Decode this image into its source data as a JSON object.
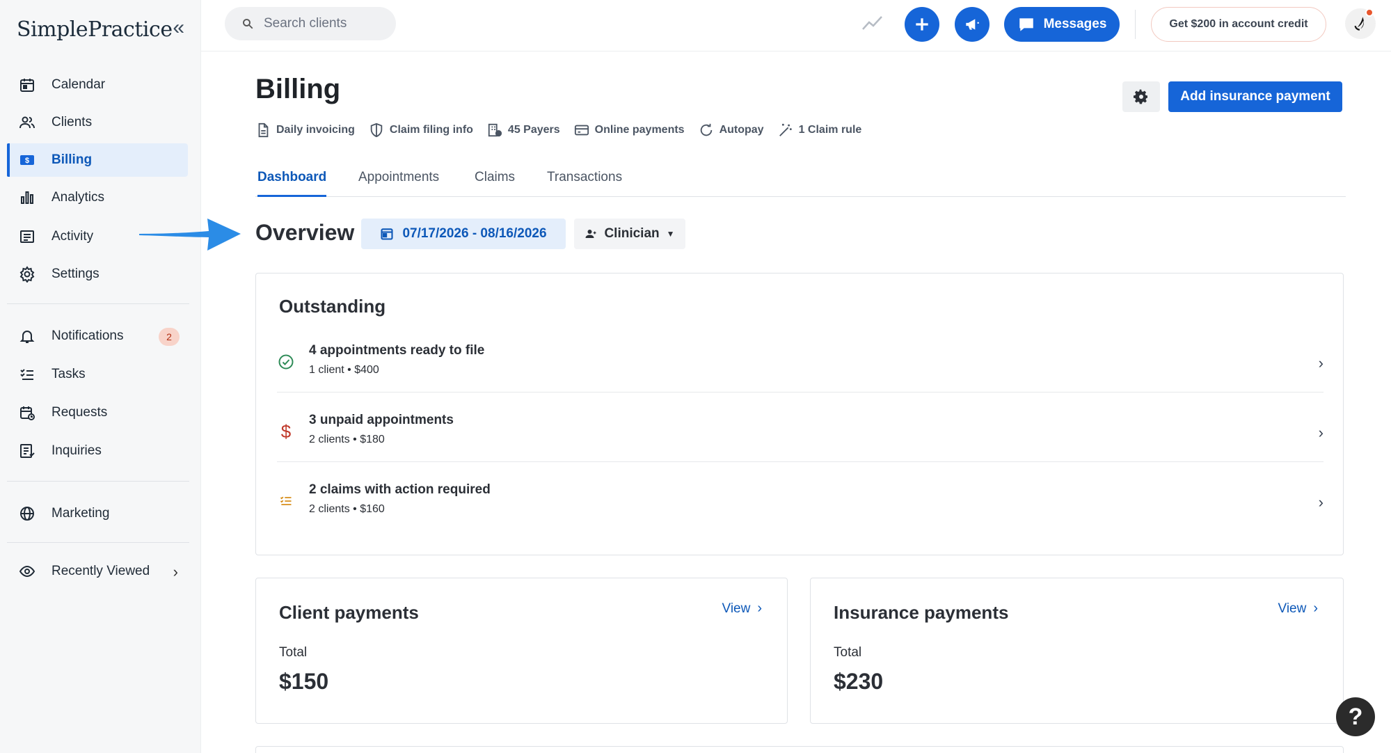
{
  "app": {
    "logo": "SimplePractice",
    "collapse_glyph": "«"
  },
  "sidebar": {
    "items": [
      {
        "label": "Calendar",
        "icon": "calendar-icon"
      },
      {
        "label": "Clients",
        "icon": "clients-icon"
      },
      {
        "label": "Billing",
        "icon": "billing-icon",
        "active": true
      },
      {
        "label": "Analytics",
        "icon": "analytics-icon"
      },
      {
        "label": "Activity",
        "icon": "activity-icon"
      },
      {
        "label": "Settings",
        "icon": "settings-icon"
      },
      {
        "label": "Notifications",
        "icon": "bell-icon",
        "badge": "2"
      },
      {
        "label": "Tasks",
        "icon": "tasks-icon"
      },
      {
        "label": "Requests",
        "icon": "requests-icon"
      },
      {
        "label": "Inquiries",
        "icon": "inquiries-icon"
      },
      {
        "label": "Marketing",
        "icon": "globe-icon"
      },
      {
        "label": "Recently Viewed",
        "icon": "eye-icon",
        "chevron": "›"
      }
    ]
  },
  "topbar": {
    "search_placeholder": "Search clients",
    "messages_label": "Messages",
    "credit_label": "Get $200 in account credit"
  },
  "page": {
    "title": "Billing",
    "add_button": "Add insurance payment",
    "links": [
      {
        "label": "Daily invoicing",
        "icon": "document-icon"
      },
      {
        "label": "Claim filing info",
        "icon": "shield-icon"
      },
      {
        "label": "45 Payers",
        "icon": "building-icon"
      },
      {
        "label": "Online payments",
        "icon": "credit-card-icon"
      },
      {
        "label": "Autopay",
        "icon": "refresh-icon"
      },
      {
        "label": "1 Claim rule",
        "icon": "magic-wand-icon"
      }
    ],
    "tabs": [
      {
        "label": "Dashboard",
        "active": true
      },
      {
        "label": "Appointments"
      },
      {
        "label": "Claims"
      },
      {
        "label": "Transactions"
      }
    ]
  },
  "overview": {
    "title": "Overview",
    "date_range": "07/17/2026 - 08/16/2026",
    "clinician_label": "Clinician"
  },
  "outstanding": {
    "title": "Outstanding",
    "rows": [
      {
        "primary": "4 appointments ready to file",
        "secondary": "1 client • $400",
        "icon": "check-circle-icon",
        "color": "#2e8b57"
      },
      {
        "primary": "3 unpaid appointments",
        "secondary": "2 clients • $180",
        "icon": "dollar-icon",
        "color": "#c0392b"
      },
      {
        "primary": "2 claims with action required",
        "secondary": "2 clients • $160",
        "icon": "list-icon",
        "color": "#d68910"
      }
    ]
  },
  "client_payments": {
    "title": "Client payments",
    "view_label": "View",
    "total_label": "Total",
    "total_value": "$150"
  },
  "insurance_payments": {
    "title": "Insurance payments",
    "view_label": "View",
    "total_label": "Total",
    "total_value": "$230"
  },
  "help": {
    "label": "?"
  },
  "colors": {
    "primary": "#1665d8",
    "active_bg": "#e4eefb",
    "arrow": "#2b8ce6"
  }
}
